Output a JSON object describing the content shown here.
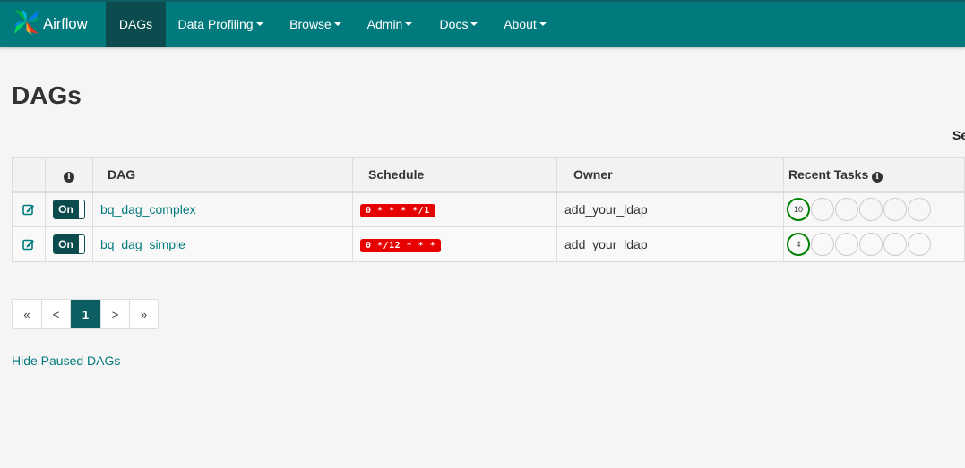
{
  "navbar": {
    "brand": "Airflow",
    "items": [
      {
        "label": "DAGs"
      },
      {
        "label": "Data Profiling"
      },
      {
        "label": "Browse"
      },
      {
        "label": "Admin"
      },
      {
        "label": "Docs"
      },
      {
        "label": "About"
      }
    ],
    "active_color": "#0b4b4d",
    "background_color": "#017a7e"
  },
  "page": {
    "title": "DAGs",
    "search_label": "Se"
  },
  "table": {
    "headers": {
      "info_icon": "info-icon",
      "dag": "DAG",
      "schedule": "Schedule",
      "owner": "Owner",
      "recent_tasks": "Recent Tasks"
    },
    "rows": [
      {
        "toggle": "On",
        "dag": "bq_dag_complex",
        "schedule": "0 * * * */1",
        "owner": "add_your_ldap",
        "recent_success_count": "10"
      },
      {
        "toggle": "On",
        "dag": "bq_dag_simple",
        "schedule": "0 */12 * * *",
        "owner": "add_your_ldap",
        "recent_success_count": "4"
      }
    ]
  },
  "pagination": {
    "first": "«",
    "prev": "<",
    "current": "1",
    "next": ">",
    "last": "»"
  },
  "links": {
    "hide_paused": "Hide Paused DAGs"
  },
  "colors": {
    "success": "#008000",
    "schedule_badge": "#e60000",
    "link": "#017a7e"
  }
}
